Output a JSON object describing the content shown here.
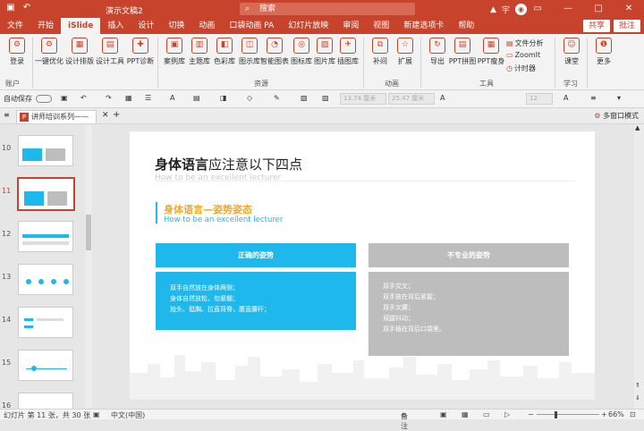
{
  "app": {
    "doc_title": "演示文稿2",
    "search_placeholder": "搜索",
    "user_initial": "宇",
    "min": "—",
    "max": "□",
    "close": "✕"
  },
  "tabs": [
    "文件",
    "开始",
    "iSlide",
    "插入",
    "设计",
    "切换",
    "动画",
    "口袋动画 PA",
    "幻灯片放映",
    "审阅",
    "视图",
    "新建选项卡",
    "帮助"
  ],
  "tabs_right": {
    "share": "共享",
    "comment": "批注"
  },
  "ribbon": {
    "account": "账户",
    "big": [
      {
        "label": "一键优化",
        "icon": "⚙"
      },
      {
        "label": "设计排版",
        "icon": "▦"
      },
      {
        "label": "设计工具",
        "icon": "▤"
      },
      {
        "label": "PPT诊断",
        "icon": "✚"
      },
      {
        "label": "案例库",
        "icon": "▣"
      },
      {
        "label": "主题库",
        "icon": "▥"
      },
      {
        "label": "色彩库",
        "icon": "◧"
      },
      {
        "label": "图示库",
        "icon": "◫"
      },
      {
        "label": "智能图表",
        "icon": "◔"
      },
      {
        "label": "图标库",
        "icon": "◎"
      },
      {
        "label": "图片库",
        "icon": "▨"
      },
      {
        "label": "插图库",
        "icon": "✈"
      },
      {
        "label": "补间",
        "icon": "⧉"
      },
      {
        "label": "扩展",
        "icon": "☆"
      },
      {
        "label": "导出",
        "icon": "↻"
      },
      {
        "label": "PPT拼图",
        "icon": "▤"
      },
      {
        "label": "PPT瘦身",
        "icon": "▦"
      },
      {
        "label": "课堂",
        "icon": "☺"
      },
      {
        "label": "更多",
        "icon": "❶"
      }
    ],
    "small": [
      "文件分析",
      "ZoomIt",
      "计时器"
    ],
    "groups": [
      "资源",
      "动画",
      "工具",
      "学习"
    ],
    "login": "登录"
  },
  "toolbar": {
    "autosave": "自动保存",
    "font_size1": "13.74 厘米",
    "font_size2": "25.47 厘米",
    "pct": "12"
  },
  "doctab": {
    "name": "讲师培训系列——",
    "layout": "多窗口模式"
  },
  "thumbs": [
    "10",
    "11",
    "12",
    "13",
    "14",
    "15",
    "16"
  ],
  "slide": {
    "title_bold": "身体语言",
    "title_rest": "应注意以下四点",
    "subtitle": "How to be an excellent lecturer",
    "section_title": "身体语言—姿势姿态",
    "section_sub": "How to be an excellent lecturer",
    "good_header": "正确的姿势",
    "bad_header": "不专业的姿势",
    "good_lines": [
      "双手自然放在身体两侧；",
      "身体自然放松，勿紧绷；",
      "抬头、挺胸、拉直背脊，腹直腰杆；"
    ],
    "bad_lines": [
      "双手交叉；",
      "双手放在背后紧握；",
      "双手叉腰；",
      "双腿抖动；",
      "双手插在背后口袋里。"
    ]
  },
  "status": {
    "slide_info": "幻灯片 第 11 张，共 30 张",
    "lang": "中文(中国)",
    "notes": "备注",
    "zoom": "66%"
  },
  "colors": {
    "brand": "#c8432c",
    "accent": "#1eb8ec",
    "gray": "#bdbdbd",
    "orange": "#f5a623"
  }
}
